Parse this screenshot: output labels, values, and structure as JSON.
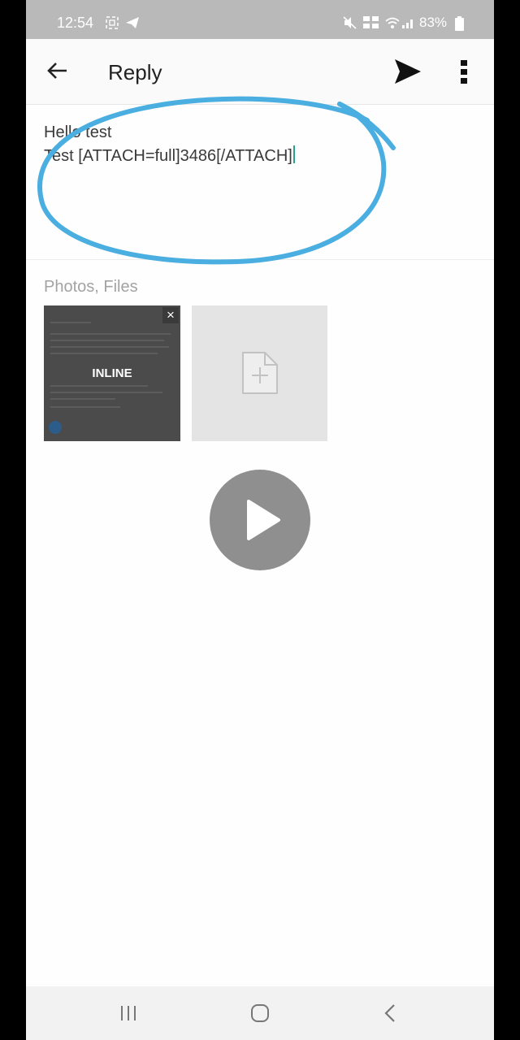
{
  "status_bar": {
    "time": "12:54",
    "battery": "83%",
    "icons": [
      "screenshot-icon",
      "telegram-icon",
      "mute-icon",
      "volte-icon",
      "wifi-icon",
      "signal-icon",
      "battery-icon"
    ]
  },
  "header": {
    "title": "Reply",
    "icons": [
      "back-arrow-icon",
      "send-icon",
      "more-vert-icon"
    ]
  },
  "message": {
    "text": "Hello test\nTest [ATTACH=full]3486[/ATTACH]"
  },
  "attachments": {
    "label": "Photos, Files",
    "items": [
      {
        "badge": "INLINE",
        "remove_glyph": "×"
      }
    ]
  },
  "colors": {
    "annotation_circle": "#4aaee0",
    "caret": "#22a38a",
    "status_bar_bg": "#b9b9b9"
  },
  "navigation": {
    "icons": [
      "recents-icon",
      "home-icon",
      "back-icon"
    ]
  }
}
